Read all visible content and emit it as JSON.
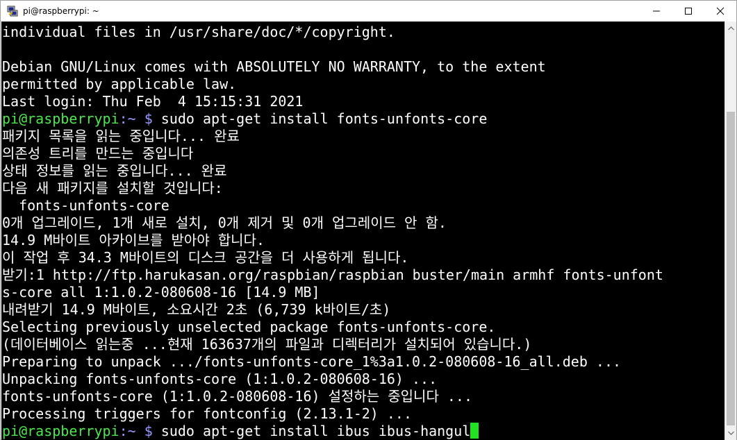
{
  "window": {
    "title": "pi@raspberrypi: ~",
    "controls": {
      "minimize": "minimize",
      "maximize": "maximize",
      "close": "close"
    }
  },
  "terminal": {
    "lines": [
      {
        "text": "individual files in /usr/share/doc/*/copyright."
      },
      {
        "text": ""
      },
      {
        "text": "Debian GNU/Linux comes with ABSOLUTELY NO WARRANTY, to the extent"
      },
      {
        "text": "permitted by applicable law."
      },
      {
        "text": "Last login: Thu Feb  4 15:15:31 2021"
      },
      {
        "prompt": "pi@raspberrypi",
        "tilde": ":~ $",
        "cmd": " sudo apt-get install fonts-unfonts-core"
      },
      {
        "text": "패키지 목록을 읽는 중입니다... 완료"
      },
      {
        "text": "의존성 트리를 만드는 중입니다"
      },
      {
        "text": "상태 정보를 읽는 중입니다... 완료"
      },
      {
        "text": "다음 새 패키지를 설치할 것입니다:"
      },
      {
        "text": "  fonts-unfonts-core"
      },
      {
        "text": "0개 업그레이드, 1개 새로 설치, 0개 제거 및 0개 업그레이드 안 함."
      },
      {
        "text": "14.9 M바이트 아카이브를 받아야 합니다."
      },
      {
        "text": "이 작업 후 34.3 M바이트의 디스크 공간을 더 사용하게 됩니다."
      },
      {
        "text": "받기:1 http://ftp.harukasan.org/raspbian/raspbian buster/main armhf fonts-unfont"
      },
      {
        "text": "s-core all 1:1.0.2-080608-16 [14.9 MB]"
      },
      {
        "text": "내려받기 14.9 M바이트, 소요시간 2초 (6,739 k바이트/초)"
      },
      {
        "text": "Selecting previously unselected package fonts-unfonts-core."
      },
      {
        "text": "(데이터베이스 읽는중 ...현재 163637개의 파일과 디렉터리가 설치되어 있습니다.)"
      },
      {
        "text": "Preparing to unpack .../fonts-unfonts-core_1%3a1.0.2-080608-16_all.deb ..."
      },
      {
        "text": "Unpacking fonts-unfonts-core (1:1.0.2-080608-16) ..."
      },
      {
        "text": "fonts-unfonts-core (1:1.0.2-080608-16) 설정하는 중입니다 ..."
      },
      {
        "text": "Processing triggers for fontconfig (2.13.1-2) ..."
      },
      {
        "prompt": "pi@raspberrypi",
        "tilde": ":~ $",
        "cmd": " sudo apt-get install ibus ibus-hangul",
        "cursor": true
      }
    ]
  },
  "colors": {
    "background": "#000000",
    "text": "#ffffff",
    "prompt": "#4ee64e",
    "path": "#9a9aff",
    "cursor": "#22e022"
  },
  "icons": {
    "app": "putty-icon",
    "minimize": "minimize-icon",
    "maximize": "maximize-icon",
    "close": "close-icon"
  }
}
